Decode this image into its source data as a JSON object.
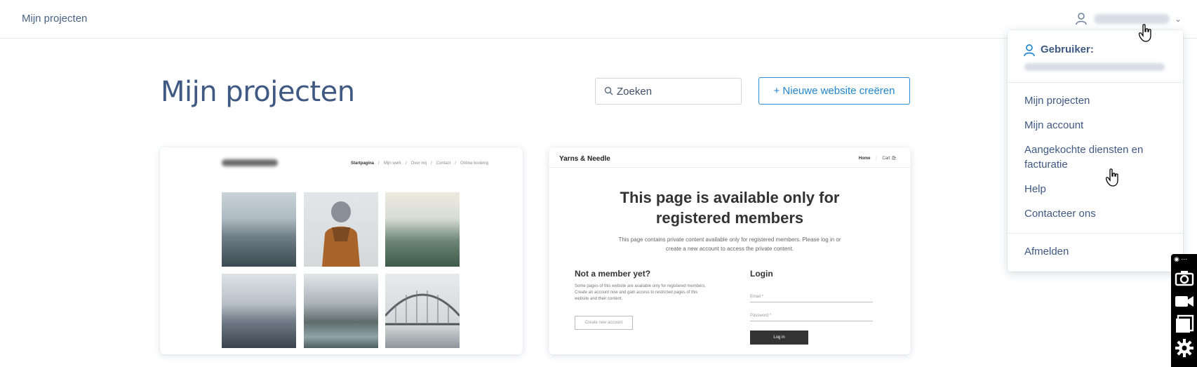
{
  "topbar": {
    "breadcrumb": "Mijn projecten"
  },
  "page": {
    "title": "Mijn projecten"
  },
  "search": {
    "placeholder": "Zoeken"
  },
  "actions": {
    "new_website": "+ Nieuwe website creëren"
  },
  "card1": {
    "nav": [
      "Startpagina",
      "/",
      "Mijn werk",
      "/",
      "Over mij",
      "/",
      "Contact",
      "/",
      "Online booking"
    ]
  },
  "card2": {
    "brand": "Yarns & Needle",
    "nav_home": "Home",
    "nav_cart": "Cart",
    "title_line1": "This page is available only for",
    "title_line2": "registered members",
    "subtitle": "This page contains private content available only for registered members. Please log in or create a new account to access the private content.",
    "left_heading": "Not a member yet?",
    "left_text": "Some pages of this website are available only for registered members. Create an account now and gain access to restricted pages of this website and their content.",
    "create_button": "Create new account",
    "right_heading": "Login",
    "email_label": "Email *",
    "password_label": "Password *",
    "login_button": "Log in"
  },
  "dropdown": {
    "user_label": "Gebruiker:",
    "items": [
      "Mijn projecten",
      "Mijn account",
      "Aangekochte diensten en facturatie",
      "Help",
      "Contacteer ons"
    ],
    "logout": "Afmelden"
  },
  "colors": {
    "accent": "#1f86cf",
    "title": "#3f5983",
    "toolbar": "#000000"
  },
  "icons": {
    "user": "user-icon",
    "search": "search-icon",
    "chevron": "chevron-down-icon",
    "camera": "camera-icon",
    "video": "video-icon",
    "window": "window-icon",
    "settings": "gear-icon"
  }
}
